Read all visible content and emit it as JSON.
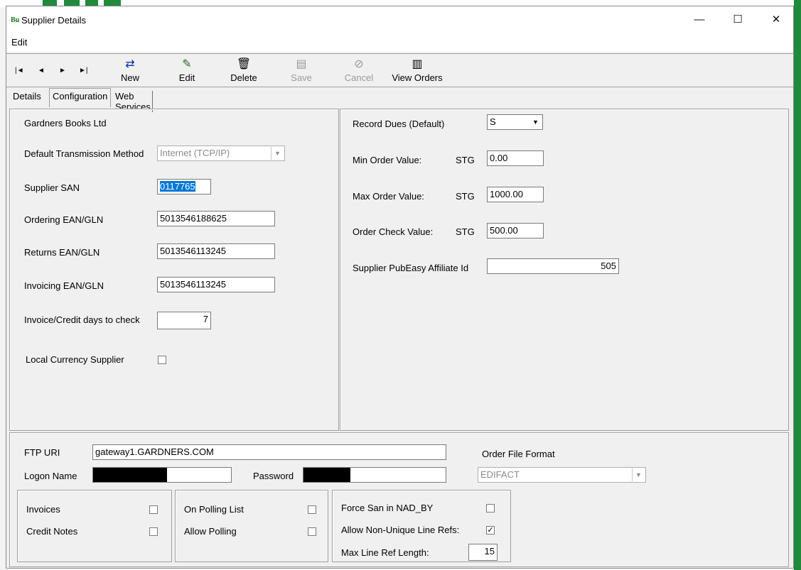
{
  "window": {
    "title": "Supplier Details",
    "app_icon_letters": "Bu",
    "minimize_glyph": "—",
    "maximize_glyph": "☐",
    "close_glyph": "✕"
  },
  "menu": {
    "edit_label": "Edit"
  },
  "toolbar": {
    "nav": [
      "|◄",
      "◄",
      "►",
      "►|"
    ],
    "buttons": [
      {
        "label": "New",
        "icon": "new-icon",
        "glyph": "⇄",
        "enabled": true
      },
      {
        "label": "Edit",
        "icon": "edit-icon",
        "glyph": "✎",
        "enabled": true
      },
      {
        "label": "Delete",
        "icon": "trash-icon",
        "glyph": "🗑",
        "enabled": true
      },
      {
        "label": "Save",
        "icon": "save-icon",
        "glyph": "▤",
        "enabled": false
      },
      {
        "label": "Cancel",
        "icon": "cancel-icon",
        "glyph": "⊘",
        "enabled": false
      },
      {
        "label": "View Orders",
        "icon": "orders-icon",
        "glyph": "▥",
        "enabled": true
      }
    ]
  },
  "tabs": [
    {
      "label": "Details",
      "active": false
    },
    {
      "label": "Configuration",
      "active": true
    },
    {
      "label": "Web Services",
      "active": false
    }
  ],
  "left": {
    "supplier_name": "Gardners Books Ltd",
    "transmission_label": "Default Transmission Method",
    "transmission_value": "Internet (TCP/IP)",
    "san_label": "Supplier SAN",
    "san_value": "0117765",
    "ordering_label": "Ordering EAN/GLN",
    "ordering_value": "5013546188625",
    "returns_label": "Returns EAN/GLN",
    "returns_value": "5013546113245",
    "invoicing_label": "Invoicing EAN/GLN",
    "invoicing_value": "5013546113245",
    "days_label": "Invoice/Credit days to check",
    "days_value": "7",
    "local_currency_label": "Local Currency Supplier",
    "local_currency_checked": false
  },
  "right": {
    "record_dues_label": "Record Dues (Default)",
    "record_dues_value": "S",
    "min_label": "Min Order Value:",
    "max_label": "Max Order Value:",
    "check_label": "Order Check Value:",
    "currency": "STG",
    "min_value": "0.00",
    "max_value": "1000.00",
    "check_value": "500.00",
    "pubeasy_label": "Supplier PubEasy Affiliate Id",
    "pubeasy_value": "505"
  },
  "ftp": {
    "uri_label": "FTP URI",
    "uri_value": "gateway1.GARDNERS.COM",
    "logon_label": "Logon Name",
    "password_label": "Password",
    "order_format_label": "Order File Format",
    "order_format_value": "EDIFACT"
  },
  "options": {
    "invoices_label": "Invoices",
    "credit_notes_label": "Credit Notes",
    "polling_list_label": "On Polling List",
    "allow_polling_label": "Allow Polling",
    "force_san_label": "Force San in NAD_BY",
    "non_unique_label": "Allow Non-Unique Line Refs:",
    "non_unique_checked": true,
    "max_ref_label": "Max Line Ref Length:",
    "max_ref_value": "15",
    "check_glyph": "✓"
  }
}
